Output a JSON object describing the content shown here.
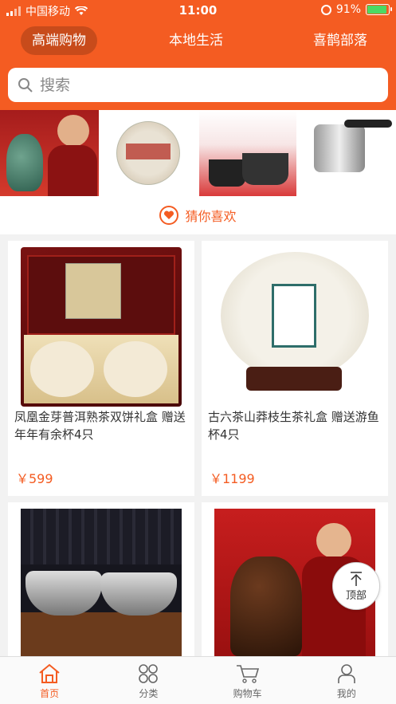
{
  "status_bar": {
    "carrier": "中国移动",
    "time": "11:00",
    "battery": "91%"
  },
  "top_tabs": [
    {
      "label": "高端购物",
      "active": true
    },
    {
      "label": "本地生活",
      "active": false
    },
    {
      "label": "喜鹊部落",
      "active": false
    }
  ],
  "search": {
    "placeholder": "搜索"
  },
  "section_title": "猜你喜欢",
  "products": [
    {
      "name": "凤凰金芽普洱熟茶双饼礼盒 赠送年年有余杯4只",
      "price": "￥599"
    },
    {
      "name": "古六茶山莽枝生茶礼盒 赠送游鱼杯4只",
      "price": "￥1199"
    },
    {
      "name": "",
      "price": ""
    },
    {
      "name": "",
      "price": ""
    }
  ],
  "back_to_top": "顶部",
  "bottom_nav": [
    {
      "label": "首页",
      "icon": "home-icon",
      "active": true
    },
    {
      "label": "分类",
      "icon": "category-icon",
      "active": false
    },
    {
      "label": "购物车",
      "icon": "cart-icon",
      "active": false
    },
    {
      "label": "我的",
      "icon": "profile-icon",
      "active": false
    }
  ],
  "colors": {
    "accent": "#f45c22"
  }
}
